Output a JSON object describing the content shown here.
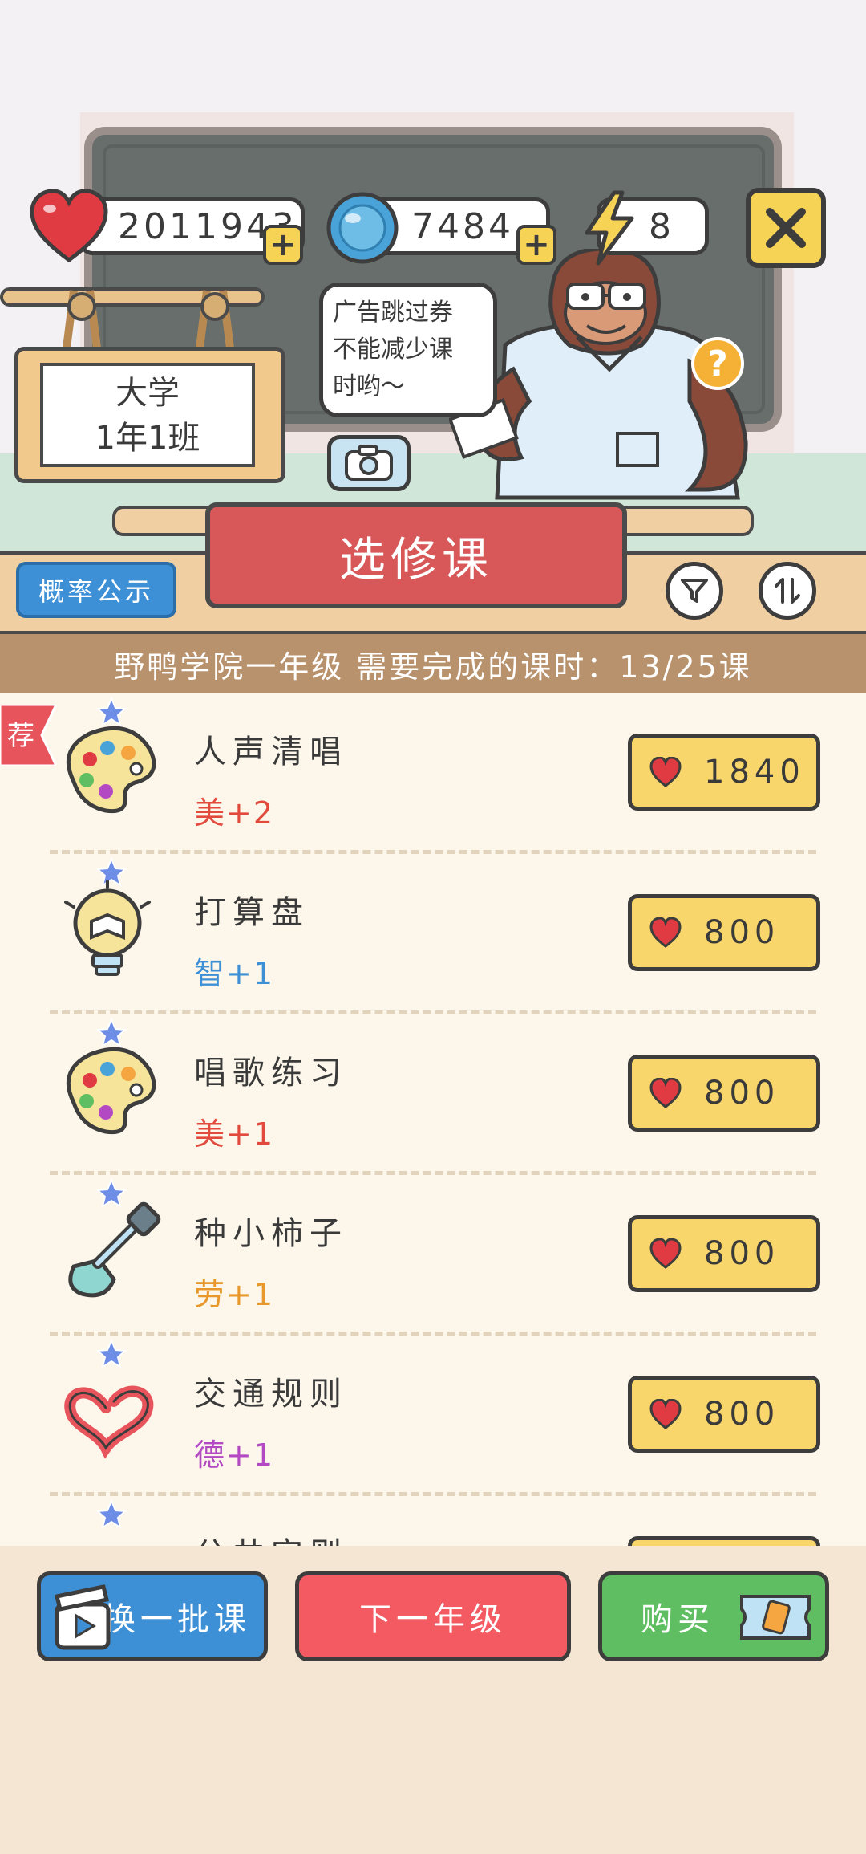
{
  "stats": {
    "hearts": "2011943",
    "coins": "7484",
    "energy": "8"
  },
  "sign": {
    "line1": "大学",
    "line2": "1年1班"
  },
  "bubble": {
    "line1": "广告跳过券",
    "line2": "不能减少课",
    "line3": "时哟～"
  },
  "header": {
    "title": "选修课",
    "probability_button": "概率公示",
    "progress": "野鸭学院一年级 需要完成的课时：13/25课"
  },
  "recommend_tag": "荐",
  "courses": [
    {
      "name": "人声清唱",
      "stat": "美+2",
      "price": "1840",
      "icon": "palette-icon",
      "color": "#e14a3c"
    },
    {
      "name": "打算盘",
      "stat": "智+1",
      "price": "800",
      "icon": "lightbulb-book-icon",
      "color": "#3d8fd6"
    },
    {
      "name": "唱歌练习",
      "stat": "美+1",
      "price": "800",
      "icon": "palette-icon",
      "color": "#e14a3c"
    },
    {
      "name": "种小柿子",
      "stat": "劳+1",
      "price": "800",
      "icon": "shovel-icon",
      "color": "#e8972a"
    },
    {
      "name": "交通规则",
      "stat": "德+1",
      "price": "800",
      "icon": "ribbon-heart-icon",
      "color": "#b34ac4"
    },
    {
      "name": "公共守则",
      "stat": "",
      "price": "",
      "icon": "ribbon-heart-icon",
      "color": "#b34ac4"
    }
  ],
  "bottom": {
    "refresh": "换一批课",
    "next_grade": "下一年级",
    "buy": "购买"
  },
  "colors": {
    "heart": "#e03a42",
    "price_bg": "#f8d66c",
    "refresh_bg": "#3d8fd6",
    "next_bg": "#f45a62",
    "buy_bg": "#5fbe62"
  }
}
